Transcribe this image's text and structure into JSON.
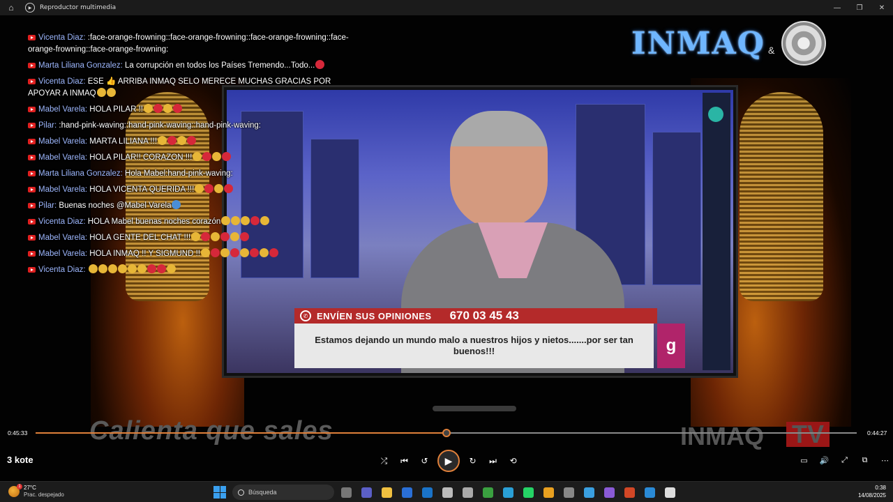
{
  "window": {
    "title": "Reproductor multimedia",
    "controls": [
      "—",
      "❐",
      "✕"
    ]
  },
  "chat": [
    {
      "author": "Vicenta Diaz:",
      "text": ":face-orange-frowning::face-orange-frowning::face-orange-frowning::face-orange-frowning::face-orange-frowning:",
      "emojis": []
    },
    {
      "author": "Marta Liliana Gonzalez:",
      "text": "La corrupción en todos los Países Tremendo...Todo...",
      "emojis": [
        "red"
      ]
    },
    {
      "author": "Vicenta Diaz:",
      "text": "ESE 👍 ARRIBA INMAQ SELO MERECE MUCHAS GRACIAS POR APOYAR A INMAQ",
      "emojis": [
        "yellow",
        "yellow"
      ]
    },
    {
      "author": "Mabel Varela:",
      "text": "HOLA PILAR !!",
      "emojis": [
        "yellow",
        "red",
        "yellow",
        "red"
      ]
    },
    {
      "author": "Pilar:",
      "text": ":hand-pink-waving::hand-pink-waving::hand-pink-waving:",
      "emojis": []
    },
    {
      "author": "Mabel Varela:",
      "text": "MARTA LILIANA !!!",
      "emojis": [
        "yellow",
        "red",
        "yellow",
        "red"
      ]
    },
    {
      "author": "Mabel Varela:",
      "text": "HOLA PILAR!! CORAZON !!!",
      "emojis": [
        "yellow",
        "red",
        "yellow",
        "red"
      ]
    },
    {
      "author": "Marta Liliana Gonzalez:",
      "text": "Hola Mabel:hand-pink-waving:",
      "emojis": []
    },
    {
      "author": "Mabel Varela:",
      "text": "HOLA VICENTA QUERIDA !!!",
      "emojis": [
        "yellow",
        "red",
        "yellow",
        "red"
      ]
    },
    {
      "author": "Pilar:",
      "text": "Buenas noches @Mabel Varela",
      "emojis": [
        "blue"
      ]
    },
    {
      "author": "Vicenta Diaz:",
      "text": "HOLA Mabel buenas noches corazón",
      "emojis": [
        "yellow",
        "yellow",
        "yellow",
        "red",
        "yellow"
      ]
    },
    {
      "author": "Mabel Varela:",
      "text": "HOLA GENTE DEL CHAT !!!",
      "emojis": [
        "yellow",
        "red",
        "yellow",
        "red",
        "yellow",
        "red"
      ]
    },
    {
      "author": "Mabel Varela:",
      "text": "HOLA INMAQ !! Y SIGMUND !!",
      "emojis": [
        "yellow",
        "red",
        "yellow",
        "red",
        "yellow",
        "red",
        "yellow",
        "red"
      ]
    },
    {
      "author": "Vicenta Diaz:",
      "text": "",
      "emojis": [
        "yellow",
        "yellow",
        "yellow",
        "yellow",
        "yellow",
        "yellow",
        "red",
        "red",
        "yellow"
      ]
    }
  ],
  "video": {
    "logo": "INMAQ",
    "logo_amp": "&",
    "lower_third": {
      "header": "ENVÍEN SUS OPINIONES",
      "phone": "670 03 45 43",
      "body": "Estamos dejando un mundo malo a nuestros hijos y nietos.......por ser tan buenos!!!",
      "badge": "g"
    },
    "slogan": "Calienta que sales",
    "watermark": "INMAQ",
    "watermark_tv": "TV"
  },
  "player": {
    "elapsed": "0:45:33",
    "remaining": "0:44:27",
    "progress": 0.5
  },
  "track_title": "3 kote",
  "controls": {
    "shuffle": "⤮",
    "prev": "⏮",
    "back10": "↺",
    "play": "▶",
    "fwd30": "↻",
    "next": "⏭",
    "repeat": "⟲"
  },
  "right_controls": [
    "▭",
    "🔊",
    "⤢",
    "⧉",
    "⋯"
  ],
  "taskbar": {
    "weather_temp": "27°C",
    "weather_desc": "Prac. despejado",
    "weather_badge": "1",
    "search_placeholder": "Búsqueda",
    "time": "0:38",
    "date": "14/08/2025",
    "apps": [
      {
        "name": "task-view-icon",
        "color": "#777"
      },
      {
        "name": "teams-icon",
        "color": "#5b5fc7"
      },
      {
        "name": "file-explorer-icon",
        "color": "#f0c040"
      },
      {
        "name": "store-icon",
        "color": "#2a6fd6"
      },
      {
        "name": "outlook-icon",
        "color": "#1a73c8"
      },
      {
        "name": "chrome-alt-icon",
        "color": "#bbb"
      },
      {
        "name": "cube-icon",
        "color": "#aaa"
      },
      {
        "name": "camtasia-icon",
        "color": "#3aa040"
      },
      {
        "name": "edge-icon",
        "color": "#2a9fd6"
      },
      {
        "name": "whatsapp-icon",
        "color": "#25d366"
      },
      {
        "name": "chrome-icon",
        "color": "#e8a020"
      },
      {
        "name": "shield-icon",
        "color": "#888"
      },
      {
        "name": "telegram-icon",
        "color": "#3a9fe0"
      },
      {
        "name": "circle-app-icon",
        "color": "#8a5ad6"
      },
      {
        "name": "powerpoint-icon",
        "color": "#d24726"
      },
      {
        "name": "paint-icon",
        "color": "#2a8ad6"
      },
      {
        "name": "media-player-icon",
        "color": "#ddd"
      }
    ]
  }
}
